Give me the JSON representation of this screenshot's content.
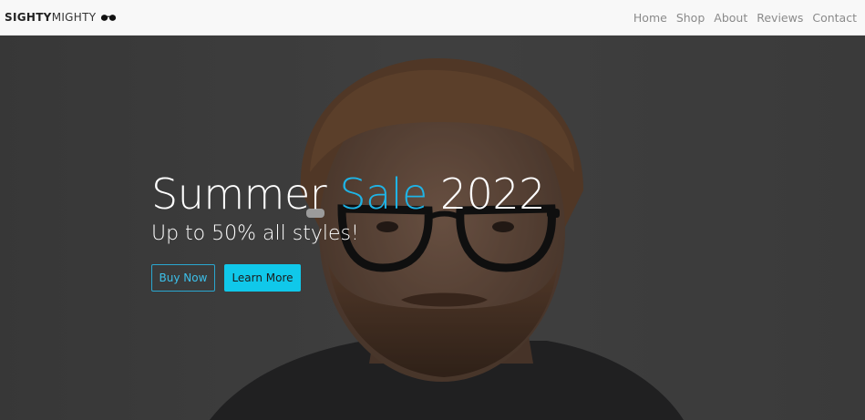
{
  "brand": {
    "part1": "SIGHTY",
    "part2": "MIGHTY",
    "icon": "glasses-icon"
  },
  "nav": {
    "items": [
      {
        "label": "Home"
      },
      {
        "label": "Shop"
      },
      {
        "label": "About"
      },
      {
        "label": "Reviews"
      },
      {
        "label": "Contact"
      }
    ]
  },
  "hero": {
    "title_part1": "Summer ",
    "title_accent": "Sale",
    "title_part2": " 2022",
    "subtitle": "Up to 50% all styles!",
    "buttons": {
      "buy": "Buy Now",
      "learn": "Learn More"
    }
  },
  "colors": {
    "accent": "#1fb4e6",
    "button_bg": "#10c8ea",
    "navbar_bg": "#f8f8f8",
    "nav_text": "#8a8a8a"
  }
}
